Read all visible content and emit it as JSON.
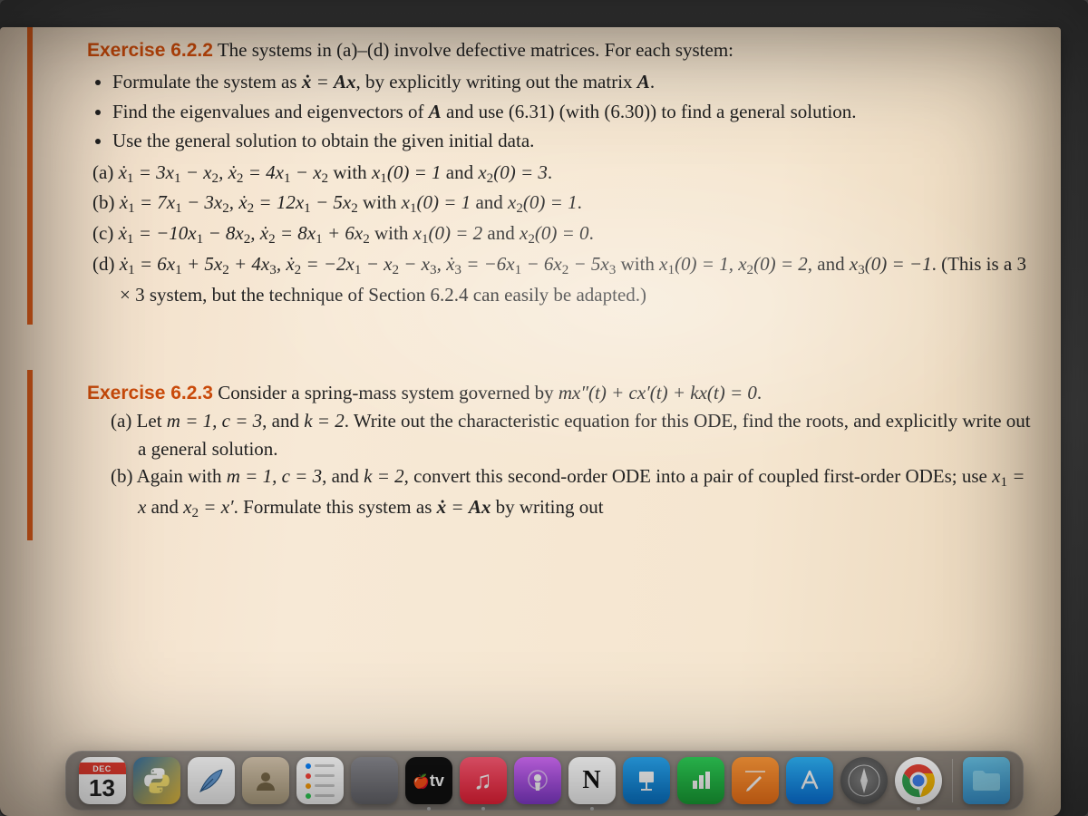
{
  "exercise_622": {
    "title": "Exercise 6.2.2",
    "intro": "The systems in (a)–(d) involve defective matrices. For each system:",
    "bullets": [
      "Formulate the system as ẋ = Ax, by explicitly writing out the matrix A.",
      "Find the eigenvalues and eigenvectors of A and use (6.31) (with (6.30)) to find a general solution.",
      "Use the general solution to obtain the given initial data."
    ],
    "parts": {
      "a": "(a) ẋ₁ = 3x₁ − x₂, ẋ₂ = 4x₁ − x₂ with x₁(0) = 1 and x₂(0) = 3.",
      "b": "(b) ẋ₁ = 7x₁ − 3x₂, ẋ₂ = 12x₁ − 5x₂ with x₁(0) = 1 and x₂(0) = 1.",
      "c": "(c) ẋ₁ = −10x₁ − 8x₂, ẋ₂ = 8x₁ + 6x₂ with x₁(0) = 2 and x₂(0) = 0.",
      "d": "(d) ẋ₁ = 6x₁ + 5x₂ + 4x₃, ẋ₂ = −2x₁ − x₂ − x₃, ẋ₃ = −6x₁ − 6x₂ − 5x₃ with x₁(0) = 1, x₂(0) = 2, and x₃(0) = −1. (This is a 3 × 3 system, but the technique of Section 6.2.4 can easily be adapted.)"
    }
  },
  "exercise_623": {
    "title": "Exercise 6.2.3",
    "intro": "Consider a spring-mass system governed by mx″(t) + cx′(t) + kx(t) = 0.",
    "parts": {
      "a": "(a) Let m = 1, c = 3, and k = 2. Write out the characteristic equation for this ODE, find the roots, and explicitly write out a general solution.",
      "b": "(b) Again with m = 1, c = 3, and k = 2, convert this second-order ODE into a pair of coupled first-order ODEs; use x₁ = x and x₂ = x′. Formulate this system as ẋ = Ax by writing out"
    }
  },
  "dock": {
    "calendar": {
      "month": "DEC",
      "day": "13"
    },
    "tv_label": "tv",
    "icons": [
      {
        "name": "calendar"
      },
      {
        "name": "python"
      },
      {
        "name": "tex"
      },
      {
        "name": "contacts"
      },
      {
        "name": "reminders"
      },
      {
        "name": "finder-alt"
      },
      {
        "name": "apple-tv"
      },
      {
        "name": "music"
      },
      {
        "name": "podcasts"
      },
      {
        "name": "notion"
      },
      {
        "name": "keynote"
      },
      {
        "name": "numbers"
      },
      {
        "name": "pages"
      },
      {
        "name": "app-store"
      },
      {
        "name": "safari-alt"
      },
      {
        "name": "chrome"
      },
      {
        "name": "files"
      }
    ]
  }
}
